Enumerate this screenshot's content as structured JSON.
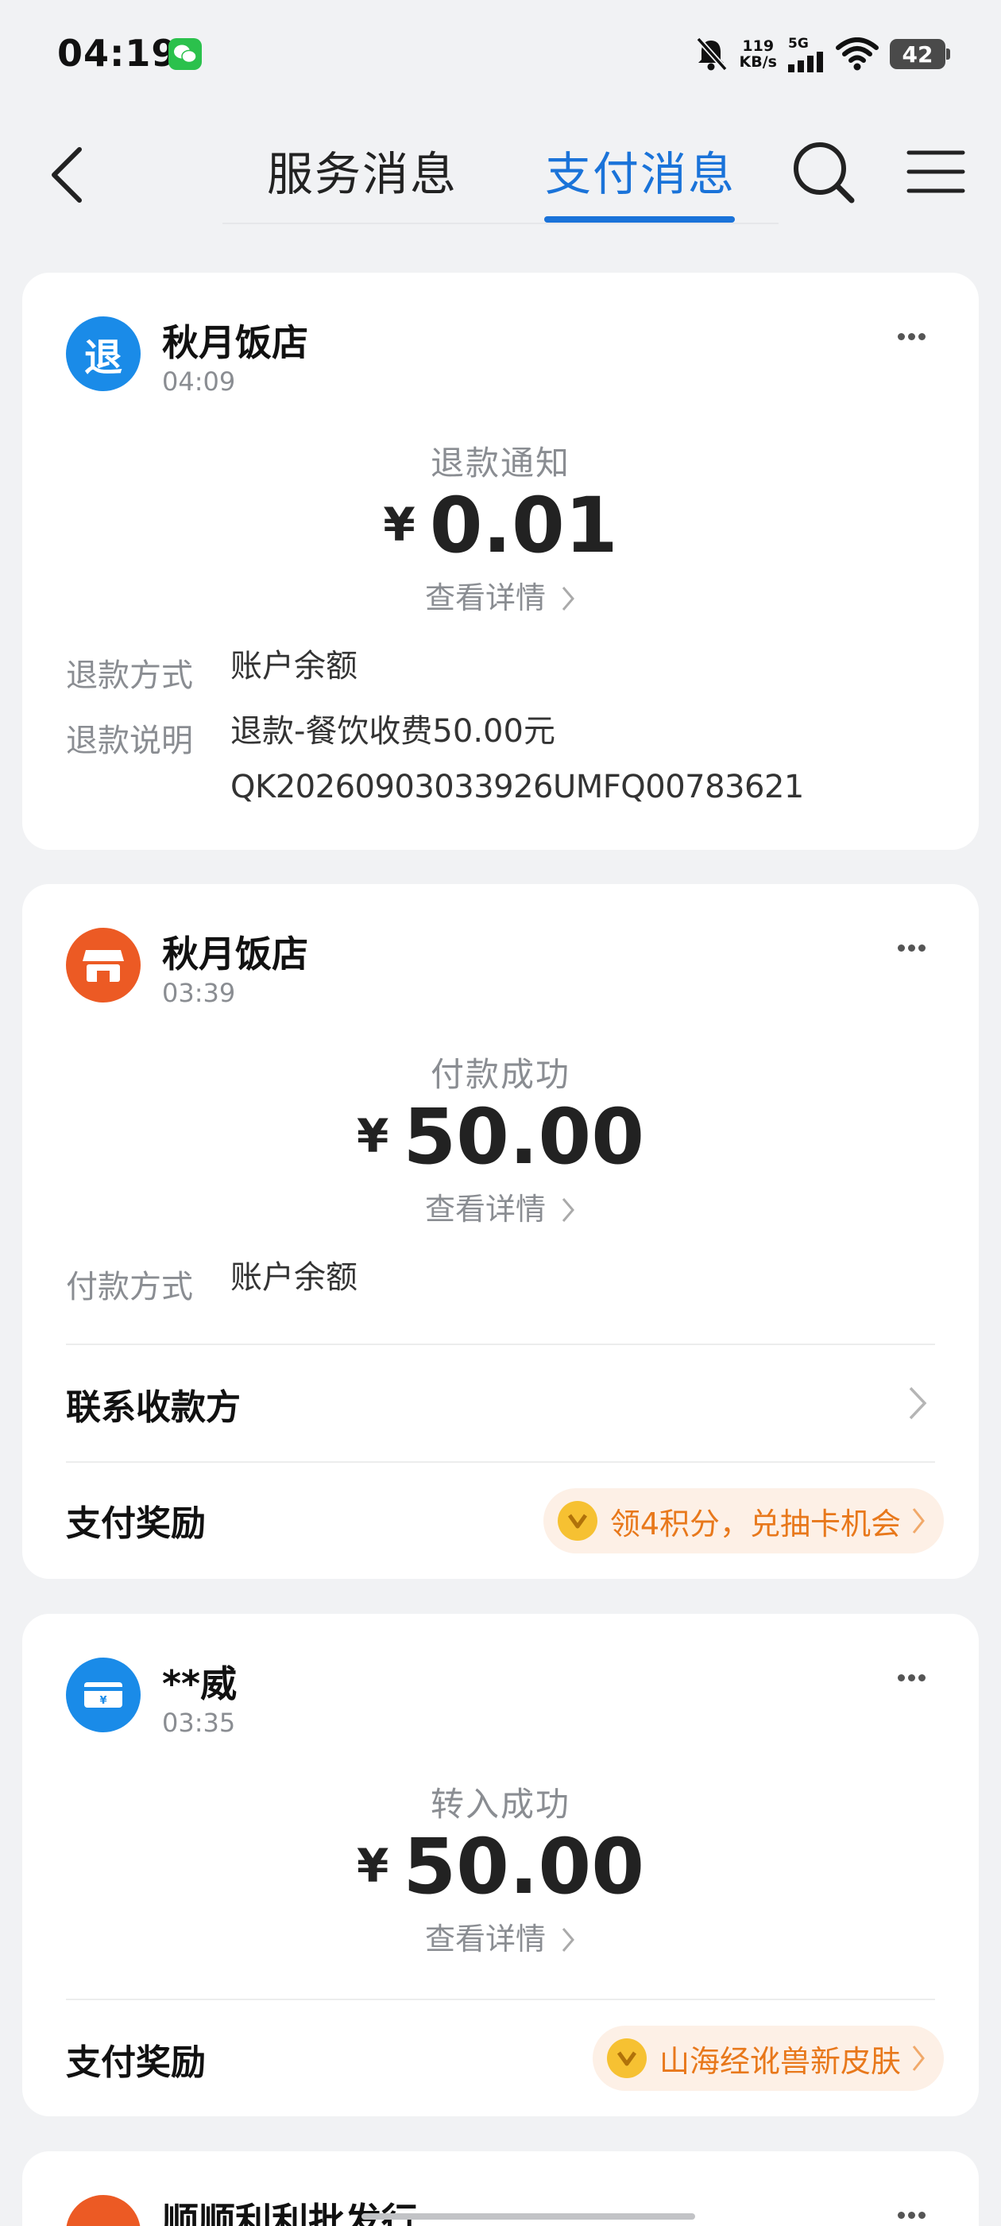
{
  "status_bar": {
    "time": "04:19",
    "net_speed_value": "119",
    "net_speed_unit": "KB/s",
    "network_type": "5G",
    "battery": "42",
    "icons": [
      "wechat-icon",
      "mute-bell-icon",
      "signal-icon",
      "wifi-icon",
      "battery-icon"
    ]
  },
  "header": {
    "tabs": [
      {
        "label": "服务消息",
        "active": false
      },
      {
        "label": "支付消息",
        "active": true
      }
    ],
    "accent_color": "#1a73d9"
  },
  "cards": [
    {
      "avatar_text": "退",
      "avatar_color": "#1a8be8",
      "merchant": "秋月饭店",
      "time": "04:09",
      "title": "退款通知",
      "currency": "¥",
      "amount": "0.01",
      "detail_link": "查看详情",
      "rows": [
        {
          "label": "退款方式",
          "value": "账户余额"
        },
        {
          "label": "退款说明",
          "value": "退款-餐饮收费50.00元",
          "value2": "QK20260903033926UMFQ00783621"
        }
      ]
    },
    {
      "avatar_icon": "shop-icon",
      "avatar_color": "#ec5a24",
      "merchant": "秋月饭店",
      "time": "03:39",
      "title": "付款成功",
      "currency": "¥",
      "amount": "50.00",
      "detail_link": "查看详情",
      "rows": [
        {
          "label": "付款方式",
          "value": "账户余额"
        }
      ],
      "contact_label": "联系收款方",
      "reward_label": "支付奖励",
      "reward_text": "领4积分，兑抽卡机会"
    },
    {
      "avatar_icon": "transfer-card-icon",
      "avatar_color": "#1a8be8",
      "merchant": "**威",
      "time": "03:35",
      "title": "转入成功",
      "currency": "¥",
      "amount": "50.00",
      "detail_link": "查看详情",
      "reward_label": "支付奖励",
      "reward_text": "山海经讹兽新皮肤"
    },
    {
      "avatar_color": "#ec5a24",
      "merchant": "顺顺利利批发行"
    }
  ]
}
